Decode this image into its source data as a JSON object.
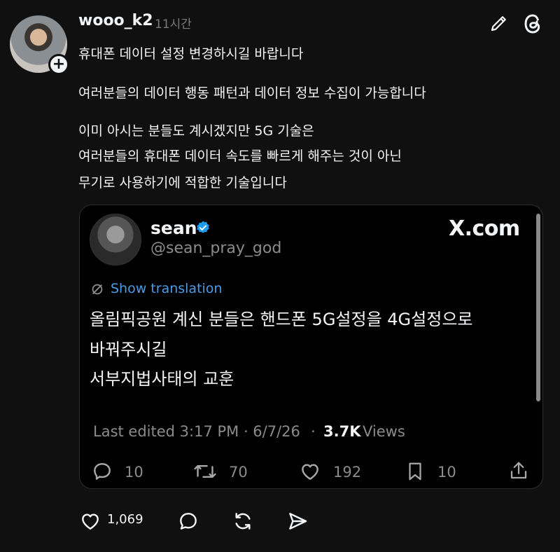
{
  "post": {
    "username": "wooo_k2",
    "timestamp": "11시간",
    "lines": [
      "휴대폰 데이터 설정 변경하시길 바랍니다",
      "여러분들의 데이터 행동 패턴과 데이터 정보 수집이 가능합니다",
      "이미 아시는 분들도 계시겠지만  5G 기술은",
      "여러분들의 휴대폰 데이터 속도를 빠르게 해주는 것이 아닌",
      "무기로 사용하기에 적합한 기술입니다"
    ]
  },
  "embed": {
    "name": "sean",
    "handle": "@sean_pray_god",
    "source": "X.com",
    "translation_link": "Show translation",
    "text_lines": [
      "올림픽공원 계신 분들은 핸드폰 5G설정을 4G설정으로",
      "바꿔주시길",
      "서부지법사태의 교훈"
    ],
    "last_edited": "Last edited 3:17 PM · 6/7/26",
    "views_count": "3.7K",
    "views_label": "Views",
    "replies": "10",
    "retweets": "70",
    "likes": "192",
    "bookmarks": "10"
  },
  "footer": {
    "likes": "1,069"
  },
  "icons": {
    "edit": "pencil-icon",
    "app": "threads-logo-icon",
    "verified": "verified-badge-icon"
  },
  "colors": {
    "background": "#101010",
    "link": "#4a9ce8",
    "verified": "#1d9bf0"
  }
}
